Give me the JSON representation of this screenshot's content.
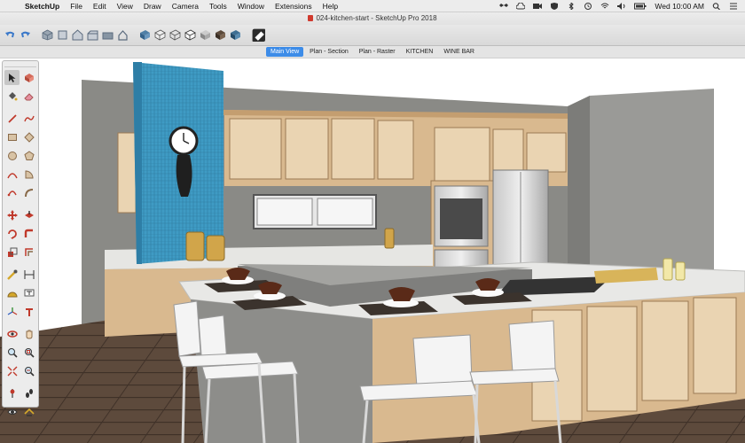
{
  "menubar": {
    "apple": "",
    "app_name": "SketchUp",
    "items": [
      "File",
      "Edit",
      "View",
      "Draw",
      "Camera",
      "Tools",
      "Window",
      "Extensions",
      "Help"
    ],
    "clock": "Wed 10:00 AM"
  },
  "window": {
    "title": "024-kitchen-start - SketchUp Pro 2018"
  },
  "toolbar": {
    "colors": {
      "undo": "#3a78c9",
      "model": "#5b6b7e",
      "views": "#7a8896",
      "styles": "#4f7fa6",
      "section": "#2b2b2b"
    }
  },
  "scenes": {
    "tabs": [
      "Main View",
      "Plan - Section",
      "Plan - Raster",
      "KITCHEN",
      "WINE BAR"
    ],
    "active_index": 0
  },
  "palette": {
    "tools": [
      "select",
      "make-component",
      "paint-bucket",
      "eraser",
      "line",
      "freehand",
      "rectangle",
      "rotated-rectangle",
      "circle",
      "polygon",
      "arc",
      "pie",
      "arc-2pt",
      "arc-3pt",
      "move",
      "push-pull",
      "rotate",
      "follow-me",
      "scale",
      "offset",
      "tape-measure",
      "dimension",
      "protractor",
      "text",
      "axes",
      "3d-text",
      "orbit",
      "pan",
      "zoom",
      "zoom-window",
      "zoom-extents",
      "previous",
      "position-camera",
      "walk",
      "look-around",
      "section-plane"
    ]
  }
}
